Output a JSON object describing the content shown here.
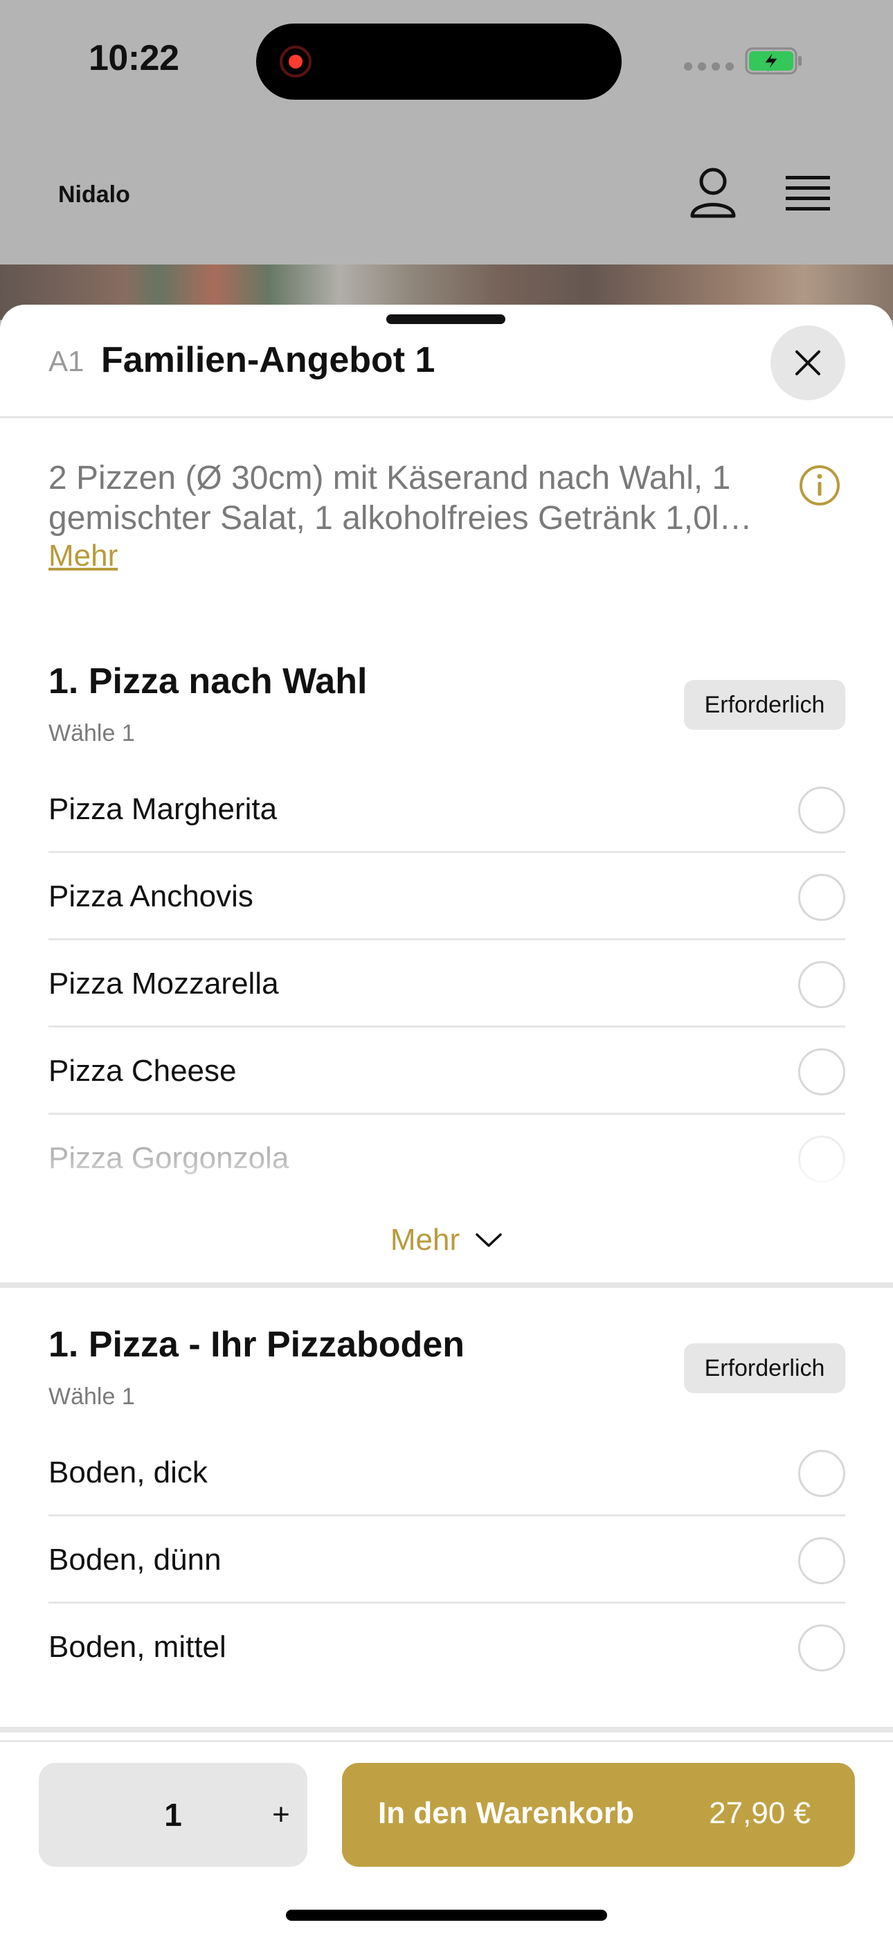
{
  "status_bar": {
    "time": "10:22"
  },
  "nav": {
    "brand": "Nidalo"
  },
  "sheet": {
    "code": "A1",
    "title": "Familien-Angebot 1",
    "description": "2 Pizzen (Ø 30cm) mit Käserand nach Wahl, 1 gemischter Salat, 1 alkoholfreies Getränk 1,0l…",
    "more_link": "Mehr"
  },
  "sections": [
    {
      "title": "1. Pizza nach Wahl",
      "subtitle": "Wähle 1",
      "badge": "Erforderlich",
      "options": [
        "Pizza Margherita",
        "Pizza Anchovis",
        "Pizza Mozzarella",
        "Pizza Cheese",
        "Pizza Gorgonzola"
      ],
      "more_label": "Mehr"
    },
    {
      "title": "1. Pizza - Ihr Pizzaboden",
      "subtitle": "Wähle 1",
      "badge": "Erforderlich",
      "options": [
        "Boden, dick",
        "Boden, dünn",
        "Boden, mittel"
      ]
    }
  ],
  "bottom": {
    "quantity": "1",
    "plus": "+",
    "cart_label": "In den Warenkorb",
    "price": "27,90 €"
  },
  "colors": {
    "accent": "#bfa143",
    "link": "#b89b3e",
    "chip": "#e6e6e6"
  }
}
